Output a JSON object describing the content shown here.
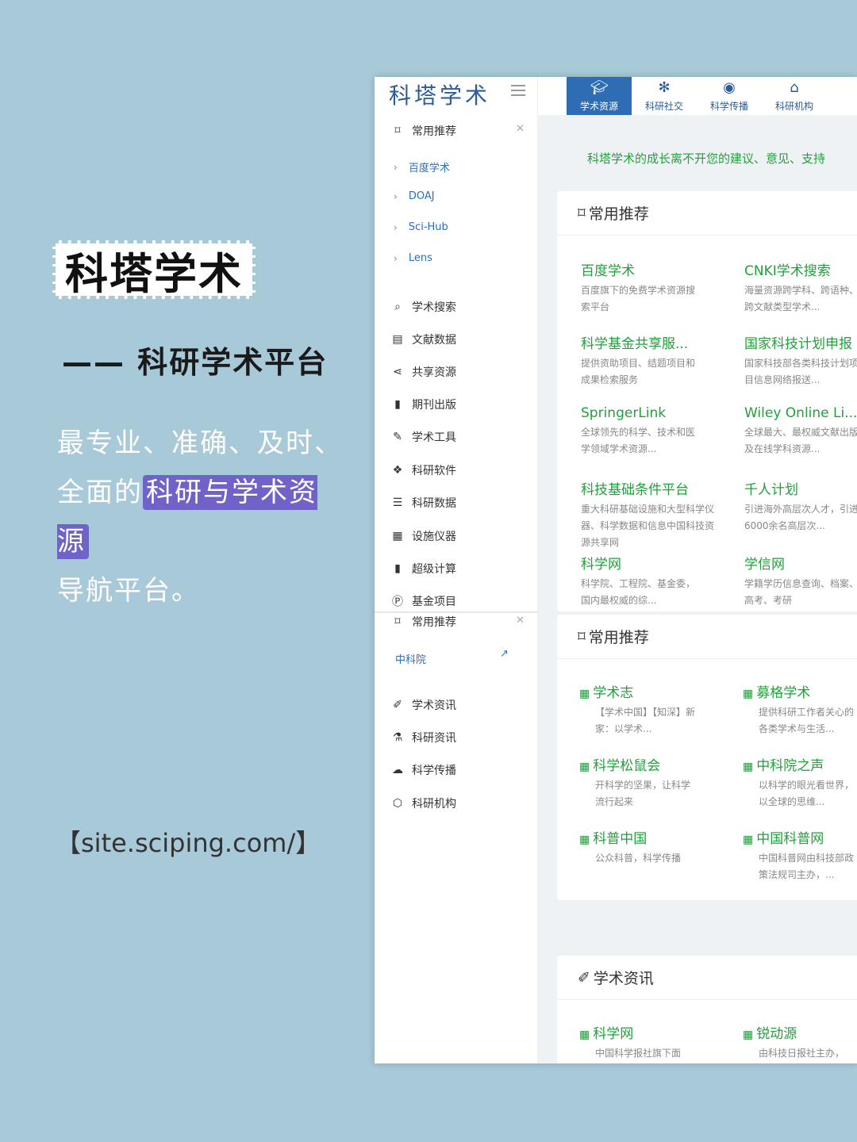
{
  "promo": {
    "title": "科塔学术",
    "subtitle": "—— 科研学术平台",
    "desc_1": "最专业、准确、及时、",
    "desc_2a": "全面的",
    "desc_2b": "科研与学术资源",
    "desc_3": "导航平台。",
    "site": "【site.sciping.com/】"
  },
  "app": {
    "logo": "科塔学术",
    "tabs": [
      {
        "label": "学术资源",
        "icon": "graduation-cap-icon"
      },
      {
        "label": "科研社交",
        "icon": "paw-icon"
      },
      {
        "label": "科学传播",
        "icon": "podcast-icon"
      },
      {
        "label": "科研机构",
        "icon": "institution-icon"
      }
    ],
    "notice": "科塔学术的成长离不开您的建议、意见、支持"
  },
  "sidebar": {
    "group1_label": "常用推荐",
    "group1_items": [
      "百度学术",
      "DOAJ",
      "Sci-Hub",
      "Lens"
    ],
    "items": [
      {
        "label": "学术搜索",
        "icon": "search-icon"
      },
      {
        "label": "文献数据",
        "icon": "list-icon"
      },
      {
        "label": "共享资源",
        "icon": "share-icon"
      },
      {
        "label": "期刊出版",
        "icon": "file-icon"
      },
      {
        "label": "学术工具",
        "icon": "wrench-icon"
      },
      {
        "label": "科研软件",
        "icon": "dropbox-icon"
      },
      {
        "label": "科研数据",
        "icon": "database-icon"
      },
      {
        "label": "设施仪器",
        "icon": "building-icon"
      },
      {
        "label": "超级计算",
        "icon": "server-icon"
      },
      {
        "label": "基金项目",
        "icon": "p-circle-icon"
      }
    ],
    "group2_label": "常用推荐",
    "group2_link": "中科院",
    "items2": [
      {
        "label": "学术资讯",
        "icon": "brush-icon"
      },
      {
        "label": "科研资讯",
        "icon": "flask-icon"
      },
      {
        "label": "科学传播",
        "icon": "cloud-icon"
      },
      {
        "label": "科研机构",
        "icon": "cube-icon"
      }
    ]
  },
  "card1": {
    "title": "常用推荐",
    "entries": [
      {
        "title": "百度学术",
        "desc": "百度旗下的免费学术资源搜索平台"
      },
      {
        "title": "CNKI学术搜索",
        "desc": "海量资源跨学科、跨语种、跨文献类型学术..."
      },
      {
        "title": "科学基金共享服...",
        "desc": "提供资助项目、结题项目和成果检索服务"
      },
      {
        "title": "国家科技计划申报",
        "desc": "国家科技部各类科技计划项目信息网络报送..."
      },
      {
        "title": "SpringerLink",
        "desc": "全球领先的科学、技术和医学领域学术资源..."
      },
      {
        "title": "Wiley Online Li...",
        "desc": "全球最大、最权威文献出版及在线学科资源..."
      },
      {
        "title": "科技基础条件平台",
        "desc": "重大科研基础设施和大型科学仪器、科学数据和信息中国科技资源共享网"
      },
      {
        "title": "千人计划",
        "desc": "引进海外高层次人才，引进6000余名高层次..."
      },
      {
        "title": "科学网",
        "desc": "科学院、工程院、基金委，国内最权威的综..."
      },
      {
        "title": "学信网",
        "desc": "学籍学历信息查询、档案、高考、考研"
      }
    ]
  },
  "card2": {
    "title": "常用推荐",
    "entries": [
      {
        "title": "学术志",
        "desc": "【学术中国】【知深】新家：以学术..."
      },
      {
        "title": "募格学术",
        "desc": "提供科研工作者关心的各类学术与生活..."
      },
      {
        "title": "科学松鼠会",
        "desc": "开科学的坚果，让科学流行起来"
      },
      {
        "title": "中科院之声",
        "desc": "以科学的眼光看世界，以全球的思维..."
      },
      {
        "title": "科普中国",
        "desc": "公众科普，科学传播"
      },
      {
        "title": "中国科普网",
        "desc": "中国科普网由科技部政策法规司主办，..."
      }
    ]
  },
  "card3": {
    "title": "学术资讯",
    "entries": [
      {
        "title": "科学网",
        "desc": "中国科学报社旗下面"
      },
      {
        "title": "锐动源",
        "desc": "由科技日报社主办，"
      }
    ]
  }
}
